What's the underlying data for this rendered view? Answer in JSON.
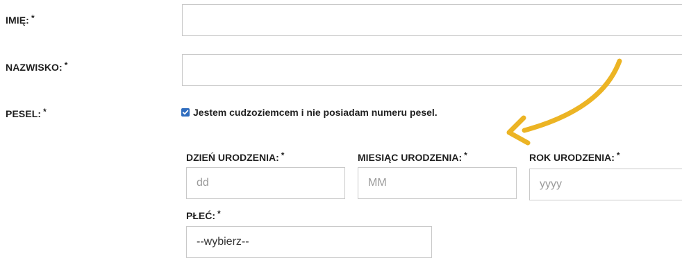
{
  "fields": {
    "first_name": {
      "label": "IMIĘ:",
      "required_mark": "*",
      "value": "",
      "placeholder": ""
    },
    "last_name": {
      "label": "NAZWISKO:",
      "required_mark": "*",
      "value": "",
      "placeholder": ""
    },
    "pesel": {
      "label": "PESEL:",
      "required_mark": "*",
      "foreigner_checkbox": {
        "checked": true,
        "label": "Jestem cudzoziemcem i nie posiadam numeru pesel."
      }
    },
    "birth_day": {
      "label": "DZIEŃ URODZENIA:",
      "required_mark": "*",
      "placeholder": "dd"
    },
    "birth_month": {
      "label": "MIESIĄC URODZENIA:",
      "required_mark": "*",
      "placeholder": "MM"
    },
    "birth_year": {
      "label": "ROK URODZENIA:",
      "required_mark": "*",
      "placeholder": "yyyy"
    },
    "gender": {
      "label": "PŁEĆ:",
      "required_mark": "*",
      "selected": "--wybierz--"
    }
  },
  "colors": {
    "checkbox": "#2f6dbf",
    "annotation_arrow": "#ecb424",
    "input_border": "#c9c9c9"
  }
}
